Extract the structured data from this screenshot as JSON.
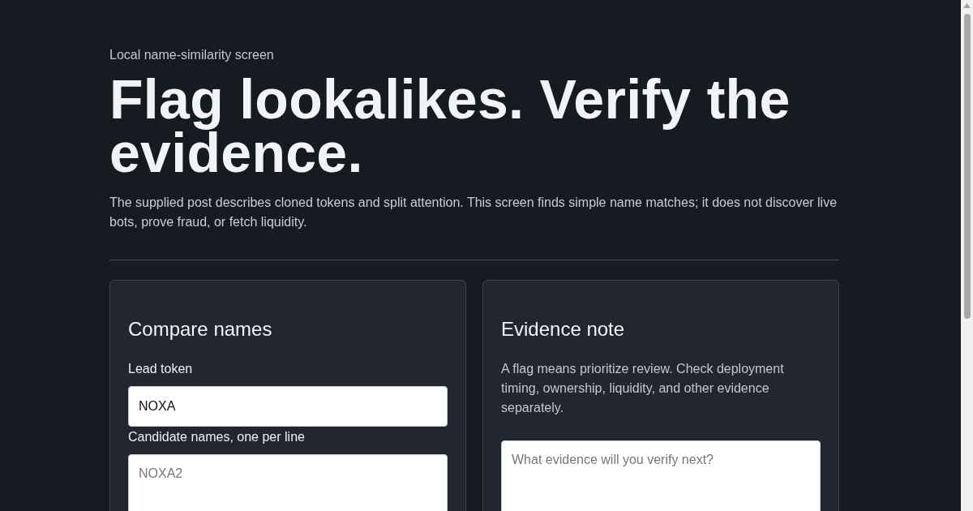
{
  "eyebrow": "Local name-similarity screen",
  "title": "Flag lookalikes. Verify the evidence.",
  "intro": "The supplied post describes cloned tokens and split attention. This screen finds simple name matches; it does not discover live bots, prove fraud, or fetch liquidity.",
  "compare": {
    "heading": "Compare names",
    "lead_label": "Lead token",
    "lead_value": "NOXA",
    "candidates_label": "Candidate names, one per line",
    "candidates_placeholder": "NOXA2"
  },
  "evidence": {
    "heading": "Evidence note",
    "text": "A flag means prioritize review. Check deployment timing, ownership, liquidity, and other evidence separately.",
    "note_placeholder": "What evidence will you verify next?"
  }
}
